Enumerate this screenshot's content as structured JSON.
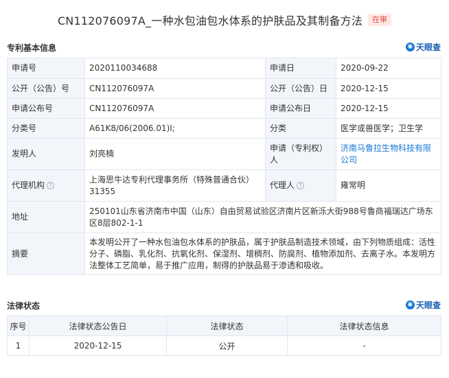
{
  "header": {
    "title": "CN112076097A_一种水包油包水体系的护肤品及其制备方法",
    "status_badge": "在审"
  },
  "basic_info": {
    "section_title": "专利基本信息",
    "brand": "天眼查",
    "rows": [
      {
        "l1": "申请号",
        "v1": "2020110034688",
        "l2": "申请日",
        "v2": "2020-09-22"
      },
      {
        "l1": "公开（公告）号",
        "v1": "CN112076097A",
        "l2": "公开（公告）日",
        "v2": "2020-12-15"
      },
      {
        "l1": "申请公布号",
        "v1": "CN112076097A",
        "l2": "申请公布日",
        "v2": "2020-12-15"
      },
      {
        "l1": "分类号",
        "v1": "A61K8/06(2006.01)I;",
        "l2": "分类",
        "v2": "医学或兽医学；卫生学"
      },
      {
        "l1": "发明人",
        "v1": "刘亮楠",
        "l2": "申请（专利权）人",
        "v2": "济南马鲁拉生物科技有限公司"
      },
      {
        "l1": "代理机构",
        "v1": "上海思牛达专利代理事务所（特殊普通合伙）31355",
        "l2": "代理人",
        "v2": "雍常明"
      }
    ],
    "address_label": "地址",
    "address_value": "250101山东省济南市中国（山东）自由贸易试验区济南片区新泺大街988号鲁商福瑞达广场东区8层802-1-1",
    "abstract_label": "摘要",
    "abstract_value": "本发明公开了一种水包油包水体系的护肤品，属于护肤品制造技术领域，由下列物质组成：活性分子、磷脂、乳化剂、抗氧化剂、保湿剂、增稠剂、防腐剂、植物添加剂、去离子水。本发明方法整体工艺简单，易于推广应用，制得的护肤品易于渗透和吸收。"
  },
  "legal_status": {
    "section_title": "法律状态",
    "brand": "天眼查",
    "columns": [
      "序号",
      "法律状态公告日",
      "法律状态",
      "法律状态信息"
    ],
    "rows": [
      {
        "index": "1",
        "date": "2020-12-15",
        "status": "公开",
        "info": "-"
      }
    ]
  }
}
